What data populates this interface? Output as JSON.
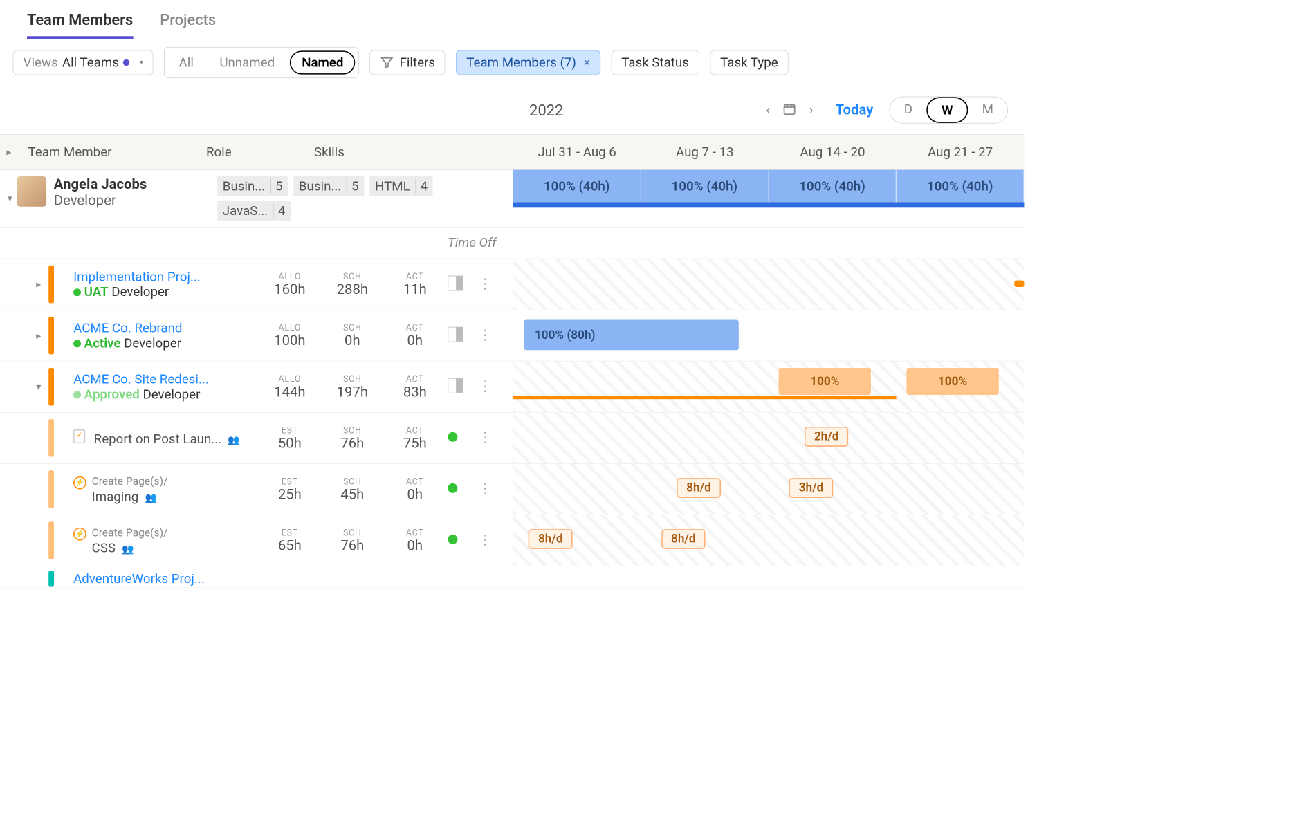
{
  "tabs": {
    "team_members": "Team Members",
    "projects": "Projects"
  },
  "toolbar": {
    "views_label": "Views",
    "views_value": "All Teams",
    "seg_all": "All",
    "seg_unnamed": "Unnamed",
    "seg_named": "Named",
    "filters": "Filters",
    "team_members_chip": "Team Members (7)",
    "task_status": "Task Status",
    "task_type": "Task Type"
  },
  "timeline": {
    "year": "2022",
    "today": "Today",
    "zoom_d": "D",
    "zoom_w": "W",
    "zoom_m": "M",
    "weeks": [
      "Jul 31 - Aug 6",
      "Aug 7 - 13",
      "Aug 14 - 20",
      "Aug 21 - 27"
    ]
  },
  "columns": {
    "team_member": "Team Member",
    "role": "Role",
    "skills": "Skills"
  },
  "member": {
    "name": "Angela Jacobs",
    "role": "Developer",
    "skills": [
      {
        "name": "Busin...",
        "level": "5"
      },
      {
        "name": "Busin...",
        "level": "5"
      },
      {
        "name": "HTML",
        "level": "4"
      },
      {
        "name": "JavaS...",
        "level": "4"
      }
    ],
    "util": [
      "100% (40h)",
      "100% (40h)",
      "100% (40h)",
      "100% (40h)"
    ]
  },
  "timeoff_label": "Time Off",
  "metrics_labels": {
    "allo": "ALLO",
    "sch": "SCH",
    "act": "ACT",
    "est": "EST"
  },
  "projects": [
    {
      "name": "Implementation Proj...",
      "status": "UAT",
      "status_class": "uat",
      "role": "Developer",
      "m1label": "ALLO",
      "m1": "160h",
      "m2": "288h",
      "m3": "11h",
      "bar": "bar-orange"
    },
    {
      "name": "ACME Co. Rebrand",
      "status": "Active",
      "status_class": "active",
      "role": "Developer",
      "m1label": "ALLO",
      "m1": "100h",
      "m2": "0h",
      "m3": "0h",
      "bar": "bar-orange",
      "seg_label": "100% (80h)"
    },
    {
      "name": "ACME Co. Site Redesi...",
      "status": "Approved",
      "status_class": "approved",
      "role": "Developer",
      "m1label": "ALLO",
      "m1": "144h",
      "m2": "197h",
      "m3": "83h",
      "bar": "bar-orange",
      "seg_w3": "100%",
      "seg_w4": "100%"
    }
  ],
  "tasks": [
    {
      "icon": "clip",
      "line1": "",
      "line2": "Report on Post Laun...",
      "m1label": "EST",
      "m1": "50h",
      "m2": "76h",
      "m3": "75h",
      "chips": [
        {
          "col": 2,
          "text": "2h/d"
        }
      ]
    },
    {
      "icon": "energy",
      "line1": "Create Page(s)/",
      "line2": "Imaging",
      "m1label": "EST",
      "m1": "25h",
      "m2": "45h",
      "m3": "0h",
      "chips": [
        {
          "col": 1,
          "text": "8h/d"
        },
        {
          "col": 2,
          "text": "3h/d"
        }
      ]
    },
    {
      "icon": "energy",
      "line1": "Create Page(s)/",
      "line2": "CSS",
      "m1label": "EST",
      "m1": "65h",
      "m2": "76h",
      "m3": "0h",
      "chips": [
        {
          "col": 0,
          "text": "8h/d"
        },
        {
          "col": 1,
          "text": "8h/d"
        }
      ]
    }
  ],
  "truncated_project": "AdventureWorks Proj..."
}
